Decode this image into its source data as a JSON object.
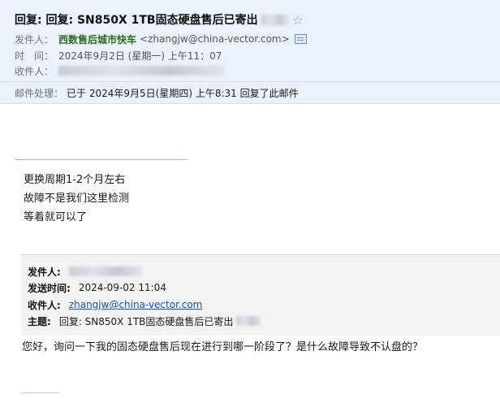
{
  "header": {
    "subject": "回复: 回复: SN850X 1TB固态硬盘售后已寄出",
    "sender_label": "发件人：",
    "sender_name": "西数售后城市快车",
    "sender_email": "<zhangjw@china-vector.com>",
    "time_label": "时　间：",
    "time_value": "2024年9月2日 (星期一) 上午11：07",
    "recipient_label": "收件人：",
    "process_label": "邮件处理：",
    "process_text": "已于 2024年9月5日(星期四) 上午8:31 回复了此邮件"
  },
  "icons": {
    "star": "star-icon",
    "contact_card": "contact-card-icon"
  },
  "body": {
    "lines": [
      "更换周期1-2个月左右",
      "故障不是我们这里检测",
      "等着就可以了"
    ]
  },
  "quote": {
    "from_label": "发件人:",
    "sent_label": "发送时间:",
    "sent_value": "2024-09-02 11:04",
    "to_label": "收件人:",
    "to_value": "zhangjw@china-vector.com",
    "subject_label": "主题:",
    "subject_value": "回复: SN850X 1TB固态硬盘售后已寄出"
  },
  "reply": {
    "text": "您好，询问一下我的固态硬盘售后现在进行到哪一阶段了？是什么故障导致不认盘的？"
  }
}
